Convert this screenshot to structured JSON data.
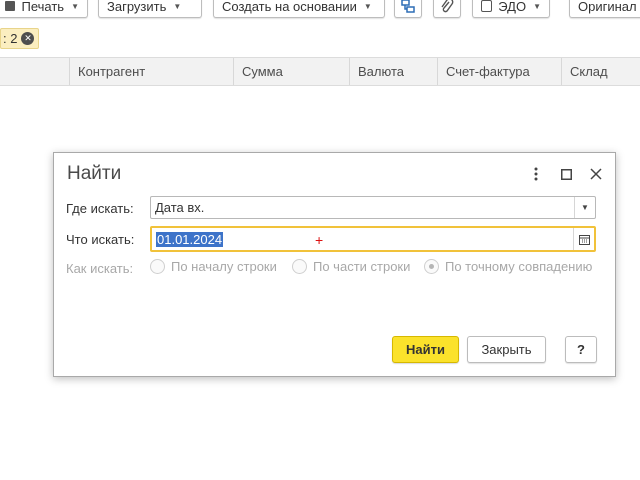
{
  "toolbar": {
    "print_label": "Печать",
    "load_label": "Загрузить",
    "create_based_label": "Создать на основании",
    "edo_label": "ЭДО",
    "original_label": "Оригинал"
  },
  "filter_chip": {
    "text": ": 2"
  },
  "table": {
    "columns": [
      "Контрагент",
      "Сумма",
      "Валюта",
      "Счет-фактура",
      "Склад"
    ]
  },
  "dialog": {
    "title": "Найти",
    "where_label": "Где искать:",
    "where_value": "Дата вх.",
    "what_label": "Что искать:",
    "what_value": "01.01.2024",
    "how_label": "Как искать:",
    "how_options": [
      "По началу строки",
      "По части строки",
      "По точному совпадению"
    ],
    "how_selected": "По точному совпадению",
    "find_button": "Найти",
    "close_button": "Закрыть",
    "help_button": "?"
  },
  "colors": {
    "accent": "#fbe22b",
    "focus_border": "#f1c23a",
    "selection": "#3d73c9"
  }
}
